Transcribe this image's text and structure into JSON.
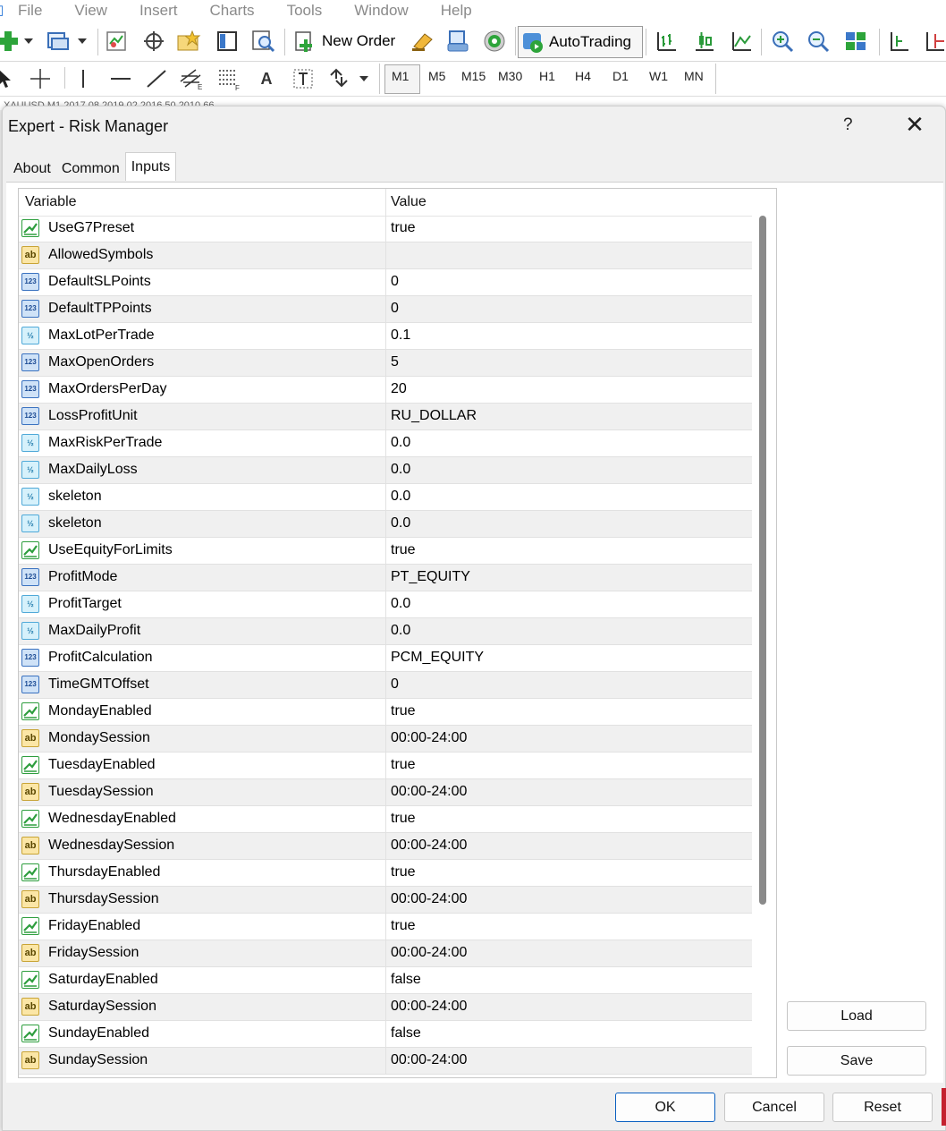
{
  "menubar": {
    "items": [
      "File",
      "View",
      "Insert",
      "Charts",
      "Tools",
      "Window",
      "Help"
    ]
  },
  "toolbar": {
    "new_order_label": "New Order",
    "autotrading_label": "AutoTrading",
    "text_tool_label": "A",
    "timeframes": [
      "M1",
      "M5",
      "M15",
      "M30",
      "H1",
      "H4",
      "D1",
      "W1",
      "MN"
    ],
    "active_timeframe": "M1"
  },
  "chart_tab_text": "XAUUSD,M1 2017.08.2019.02.2016.50.2010.66",
  "dialog": {
    "title": "Expert - Risk Manager",
    "help": "?",
    "close": "✕",
    "tabs": [
      "About",
      "Common",
      "Inputs"
    ],
    "active_tab": "Inputs",
    "columns": {
      "variable": "Variable",
      "value": "Value"
    },
    "rows": [
      {
        "type": "bool",
        "icon": "bool-icon",
        "variable": "UseG7Preset",
        "value": "true"
      },
      {
        "type": "string",
        "icon": "string-icon",
        "variable": "AllowedSymbols",
        "value": ""
      },
      {
        "type": "int",
        "icon": "int-icon",
        "variable": "DefaultSLPoints",
        "value": "0"
      },
      {
        "type": "int",
        "icon": "int-icon",
        "variable": "DefaultTPPoints",
        "value": "0"
      },
      {
        "type": "double",
        "icon": "double-icon",
        "variable": "MaxLotPerTrade",
        "value": "0.1"
      },
      {
        "type": "int",
        "icon": "int-icon",
        "variable": "MaxOpenOrders",
        "value": "5"
      },
      {
        "type": "int",
        "icon": "int-icon",
        "variable": "MaxOrdersPerDay",
        "value": "20"
      },
      {
        "type": "int",
        "icon": "int-icon",
        "variable": "LossProfitUnit",
        "value": "RU_DOLLAR"
      },
      {
        "type": "double",
        "icon": "double-icon",
        "variable": "MaxRiskPerTrade",
        "value": "0.0"
      },
      {
        "type": "double",
        "icon": "double-icon",
        "variable": "MaxDailyLoss",
        "value": "0.0"
      },
      {
        "type": "double",
        "icon": "double-icon",
        "variable": "skeleton",
        "value": "0.0"
      },
      {
        "type": "double",
        "icon": "double-icon",
        "variable": "skeleton",
        "value": "0.0"
      },
      {
        "type": "bool",
        "icon": "bool-icon",
        "variable": "UseEquityForLimits",
        "value": "true"
      },
      {
        "type": "int",
        "icon": "int-icon",
        "variable": "ProfitMode",
        "value": "PT_EQUITY"
      },
      {
        "type": "double",
        "icon": "double-icon",
        "variable": "ProfitTarget",
        "value": "0.0"
      },
      {
        "type": "double",
        "icon": "double-icon",
        "variable": "MaxDailyProfit",
        "value": "0.0"
      },
      {
        "type": "int",
        "icon": "int-icon",
        "variable": "ProfitCalculation",
        "value": "PCM_EQUITY"
      },
      {
        "type": "int",
        "icon": "int-icon",
        "variable": "TimeGMTOffset",
        "value": "0"
      },
      {
        "type": "bool",
        "icon": "bool-icon",
        "variable": "MondayEnabled",
        "value": "true"
      },
      {
        "type": "string",
        "icon": "string-icon",
        "variable": "MondaySession",
        "value": "00:00-24:00"
      },
      {
        "type": "bool",
        "icon": "bool-icon",
        "variable": "TuesdayEnabled",
        "value": "true"
      },
      {
        "type": "string",
        "icon": "string-icon",
        "variable": "TuesdaySession",
        "value": "00:00-24:00"
      },
      {
        "type": "bool",
        "icon": "bool-icon",
        "variable": "WednesdayEnabled",
        "value": "true"
      },
      {
        "type": "string",
        "icon": "string-icon",
        "variable": "WednesdaySession",
        "value": "00:00-24:00"
      },
      {
        "type": "bool",
        "icon": "bool-icon",
        "variable": "ThursdayEnabled",
        "value": "true"
      },
      {
        "type": "string",
        "icon": "string-icon",
        "variable": "ThursdaySession",
        "value": "00:00-24:00"
      },
      {
        "type": "bool",
        "icon": "bool-icon",
        "variable": "FridayEnabled",
        "value": "true"
      },
      {
        "type": "string",
        "icon": "string-icon",
        "variable": "FridaySession",
        "value": "00:00-24:00"
      },
      {
        "type": "bool",
        "icon": "bool-icon",
        "variable": "SaturdayEnabled",
        "value": "false"
      },
      {
        "type": "string",
        "icon": "string-icon",
        "variable": "SaturdaySession",
        "value": "00:00-24:00"
      },
      {
        "type": "bool",
        "icon": "bool-icon",
        "variable": "SundayEnabled",
        "value": "false"
      },
      {
        "type": "string",
        "icon": "string-icon",
        "variable": "SundaySession",
        "value": "00:00-24:00"
      }
    ],
    "buttons": {
      "load": "Load",
      "save": "Save",
      "ok": "OK",
      "cancel": "Cancel",
      "reset": "Reset"
    }
  },
  "colors": {
    "bool_icon": "#2e9e3e",
    "string_icon": "#c8a436",
    "int_icon": "#3a72c0",
    "double_icon": "#4fa9d8",
    "ok_border": "#0a5fc0",
    "accent_red": "#c4202e"
  }
}
